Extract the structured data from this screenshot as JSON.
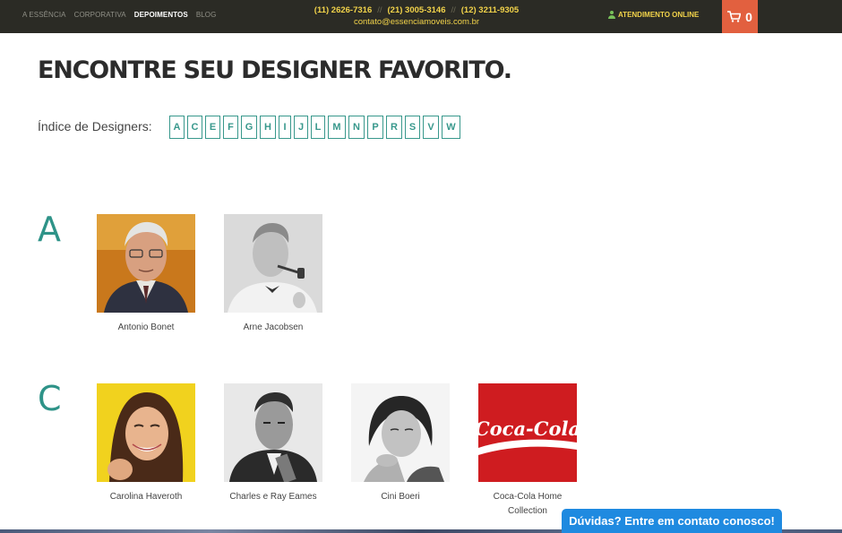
{
  "topbar": {
    "nav": [
      {
        "label": "A ESSÊNCIA",
        "active": false
      },
      {
        "label": "CORPORATIVA",
        "active": false
      },
      {
        "label": "DEPOIMENTOS",
        "active": true
      },
      {
        "label": "BLOG",
        "active": false
      }
    ],
    "phone1": "(11) 2626-7316",
    "phone2": "(21) 3005-3146",
    "phone3": "(12) 3211-9305",
    "separator": "//",
    "email": "contato@essenciamoveis.com.br",
    "atendimento_label": "ATENDIMENTO ONLINE",
    "cart_count": "0"
  },
  "page_title": "ENCONTRE SEU DESIGNER FAVORITO.",
  "index": {
    "label": "Índice de Designers:",
    "letters": [
      "A",
      "C",
      "E",
      "F",
      "G",
      "H",
      "I",
      "J",
      "L",
      "M",
      "N",
      "P",
      "R",
      "S",
      "V",
      "W"
    ]
  },
  "sections": [
    {
      "letter": "A",
      "designers": [
        {
          "name": "Antonio Bonet",
          "photo": "portrait-photo"
        },
        {
          "name": "Arne Jacobsen",
          "photo": "portrait-photo"
        }
      ]
    },
    {
      "letter": "C",
      "designers": [
        {
          "name": "Carolina Haveroth",
          "photo": "portrait-photo"
        },
        {
          "name": "Charles e Ray Eames",
          "photo": "portrait-photo"
        },
        {
          "name": "Cini Boeri",
          "photo": "portrait-photo"
        },
        {
          "name": "Coca-Cola Home Collection",
          "photo": "coca-cola-logo",
          "logo_text": "Coca-Cola"
        }
      ]
    }
  ],
  "chat": {
    "label": "Dúvidas? Entre em contato conosco!"
  },
  "colors": {
    "accent": "#38988c",
    "topbar": "#2b2b25",
    "cart": "#e2603f",
    "chat": "#1f8ae0",
    "phone_text": "#f2d34a"
  }
}
